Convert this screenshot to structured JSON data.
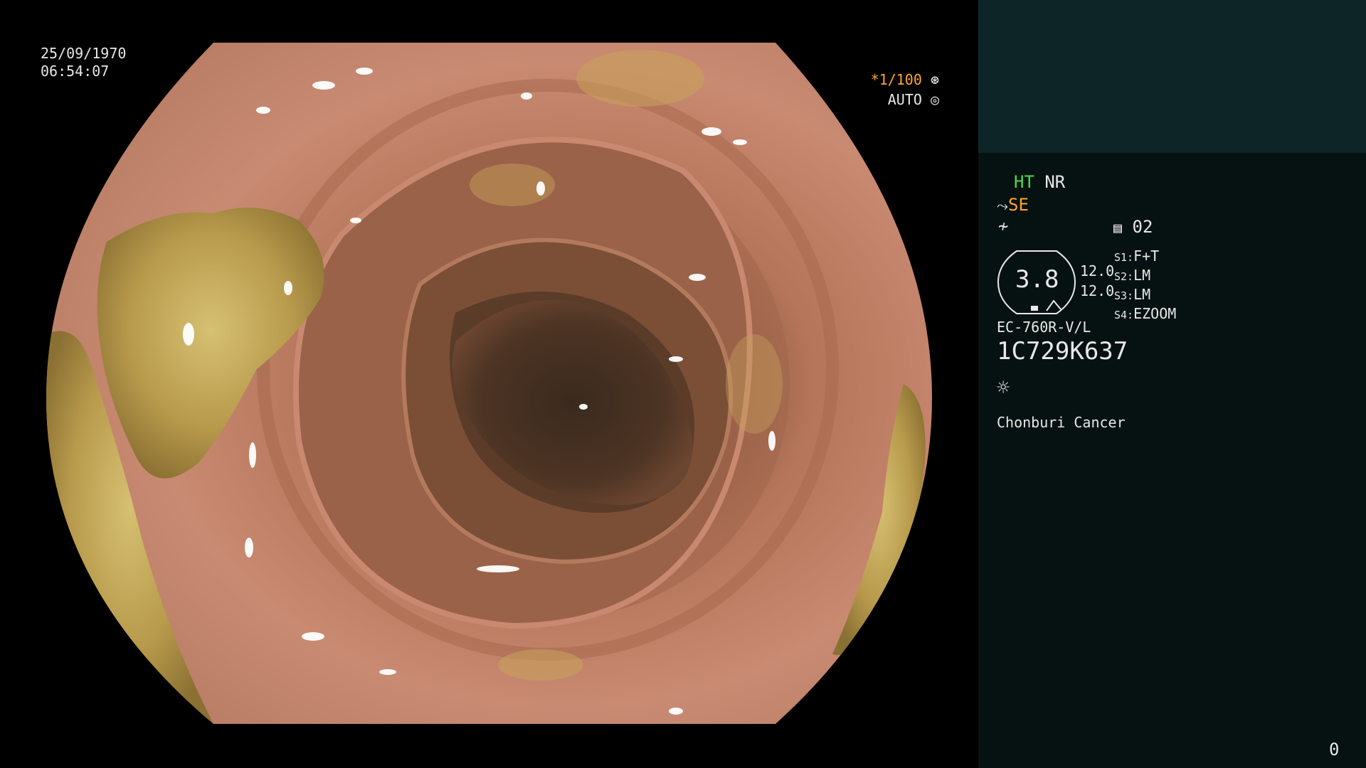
{
  "overlay": {
    "date": "25/09/1970",
    "time": "06:54:07",
    "shutter_prefix": "*",
    "shutter_value": "1/100",
    "iris_mode": "AUTO"
  },
  "panel": {
    "ht_label": "HT",
    "nr_label": "NR",
    "se_label": "SE",
    "memo_number": "02",
    "zoom_value": "3.8",
    "zoom_a": "12.0",
    "zoom_b": "12.0",
    "switches": [
      {
        "key": "S1:",
        "value": "F+T"
      },
      {
        "key": "S2:",
        "value": "LM"
      },
      {
        "key": "S3:",
        "value": "LM"
      },
      {
        "key": "S4:",
        "value": "EZOOM"
      }
    ],
    "scope_model": "EC-760R-V/L",
    "scope_serial": "1C729K637",
    "institution": "Chonburi Cancer",
    "frame_counter": "0"
  },
  "colors": {
    "accent_orange": "#ffa533",
    "accent_green": "#4fd84f",
    "panel_top": "#0d2526",
    "panel_bottom": "#061211"
  }
}
